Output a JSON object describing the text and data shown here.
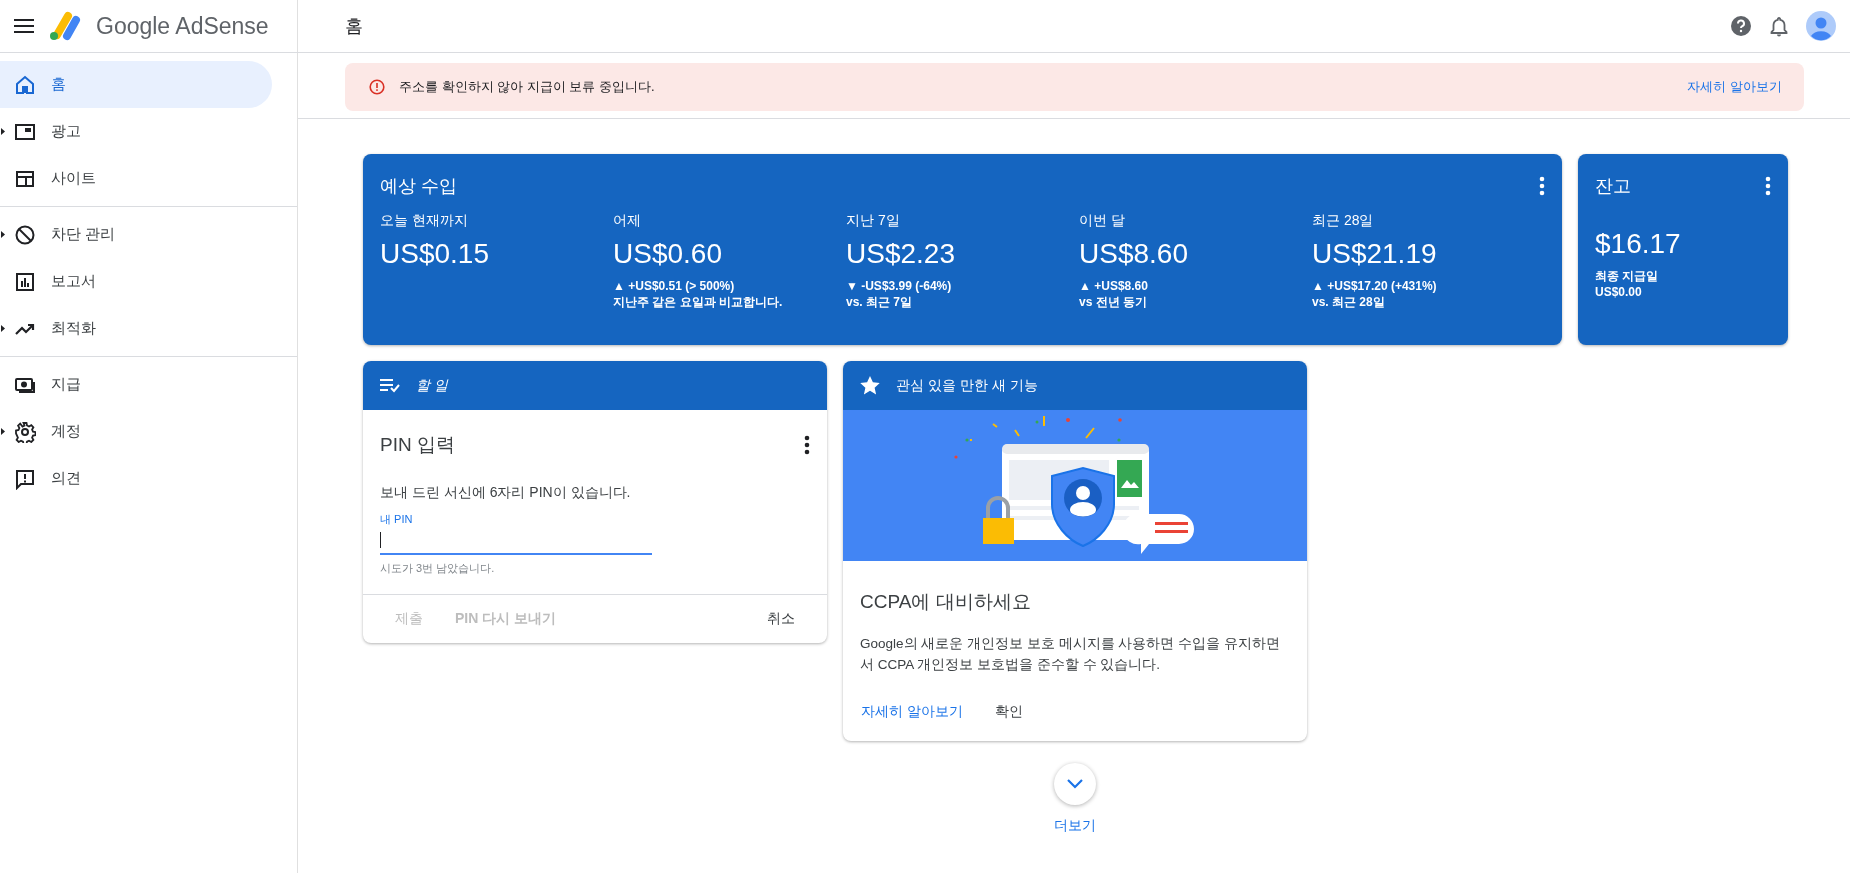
{
  "header": {
    "product": "Google AdSense",
    "page_title": "홈"
  },
  "sidebar": {
    "sections": [
      {
        "items": [
          {
            "label": "홈",
            "selected": true,
            "expandable": false
          },
          {
            "label": "광고",
            "selected": false,
            "expandable": true
          },
          {
            "label": "사이트",
            "selected": false,
            "expandable": false
          }
        ]
      },
      {
        "items": [
          {
            "label": "차단 관리",
            "selected": false,
            "expandable": true
          },
          {
            "label": "보고서",
            "selected": false,
            "expandable": false
          },
          {
            "label": "최적화",
            "selected": false,
            "expandable": true
          }
        ]
      },
      {
        "items": [
          {
            "label": "지급",
            "selected": false,
            "expandable": false
          },
          {
            "label": "계정",
            "selected": false,
            "expandable": true
          },
          {
            "label": "의견",
            "selected": false,
            "expandable": false
          }
        ]
      }
    ]
  },
  "alert": {
    "message": "주소를 확인하지 않아 지급이 보류 중입니다.",
    "link": "자세히 알아보기"
  },
  "earnings": {
    "title": "예상 수입",
    "periods": [
      {
        "label": "오늘 현재까지",
        "amount": "US$0.15"
      },
      {
        "label": "어제",
        "amount": "US$0.60",
        "change": "▲ +US$0.51 (> 500%)",
        "comparison": "지난주 같은 요일과 비교합니다."
      },
      {
        "label": "지난 7일",
        "amount": "US$2.23",
        "change": "▼ -US$3.99 (-64%)",
        "comparison": "vs. 최근 7일"
      },
      {
        "label": "이번 달",
        "amount": "US$8.60",
        "change": "▲ +US$8.60",
        "comparison": "vs 전년 동기"
      },
      {
        "label": "최근 28일",
        "amount": "US$21.19",
        "change": "▲ +US$17.20 (+431%)",
        "comparison": "vs. 최근 28일"
      }
    ]
  },
  "balance": {
    "title": "잔고",
    "amount": "$16.17",
    "last_payment_label": "최종 지급일",
    "last_payment_amount": "US$0.00"
  },
  "todo": {
    "header": "할 일",
    "title": "PIN 입력",
    "description": "보내 드린 서신에 6자리 PIN이 있습니다.",
    "field_label": "내 PIN",
    "focused": true,
    "helper": "시도가 3번 남았습니다.",
    "actions": [
      {
        "label": "제출",
        "disabled": true
      },
      {
        "label": "PIN 다시 보내기",
        "disabled": true
      },
      {
        "label": "취소",
        "disabled": false
      }
    ]
  },
  "feature": {
    "header": "관심 있을 만한 새 기능",
    "title": "CCPA에 대비하세요",
    "body": "Google의 새로운 개인정보 보호 메시지를 사용하면 수입을 유지하면서 CCPA 개인정보 보호법을 준수할 수 있습니다.",
    "actions": [
      {
        "label": "자세히 알아보기",
        "kind": "link"
      },
      {
        "label": "확인",
        "kind": "plain"
      }
    ]
  },
  "more": {
    "label": "더보기"
  }
}
